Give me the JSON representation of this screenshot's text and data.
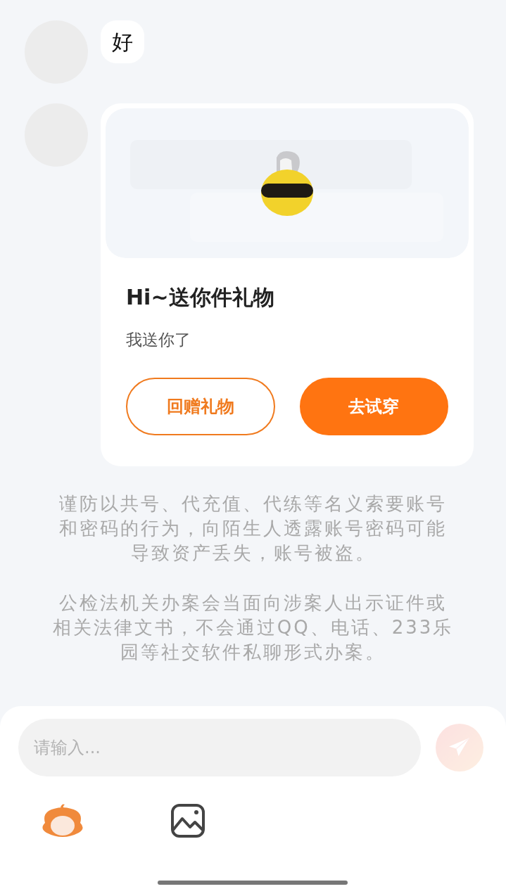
{
  "messages": [
    {
      "kind": "text",
      "text": "好"
    },
    {
      "kind": "gift_card",
      "title": "Hi~送你件礼物",
      "subtitle": "我送你了",
      "buttons": [
        {
          "label": "回赠礼物",
          "primary": false
        },
        {
          "label": "去试穿",
          "primary": true
        }
      ]
    }
  ],
  "notices": [
    "谨防以共号、代充值、代练等名义索要账号和密码的行为，向陌生人透露账号密码可能导致资产丢失，账号被盗。",
    "公检法机关办案会当面向涉案人出示证件或相关法律文书，不会通过QQ、电话、233乐园等社交软件私聊形式办案。"
  ],
  "composer": {
    "placeholder": "请输入...",
    "send_disabled": true
  }
}
